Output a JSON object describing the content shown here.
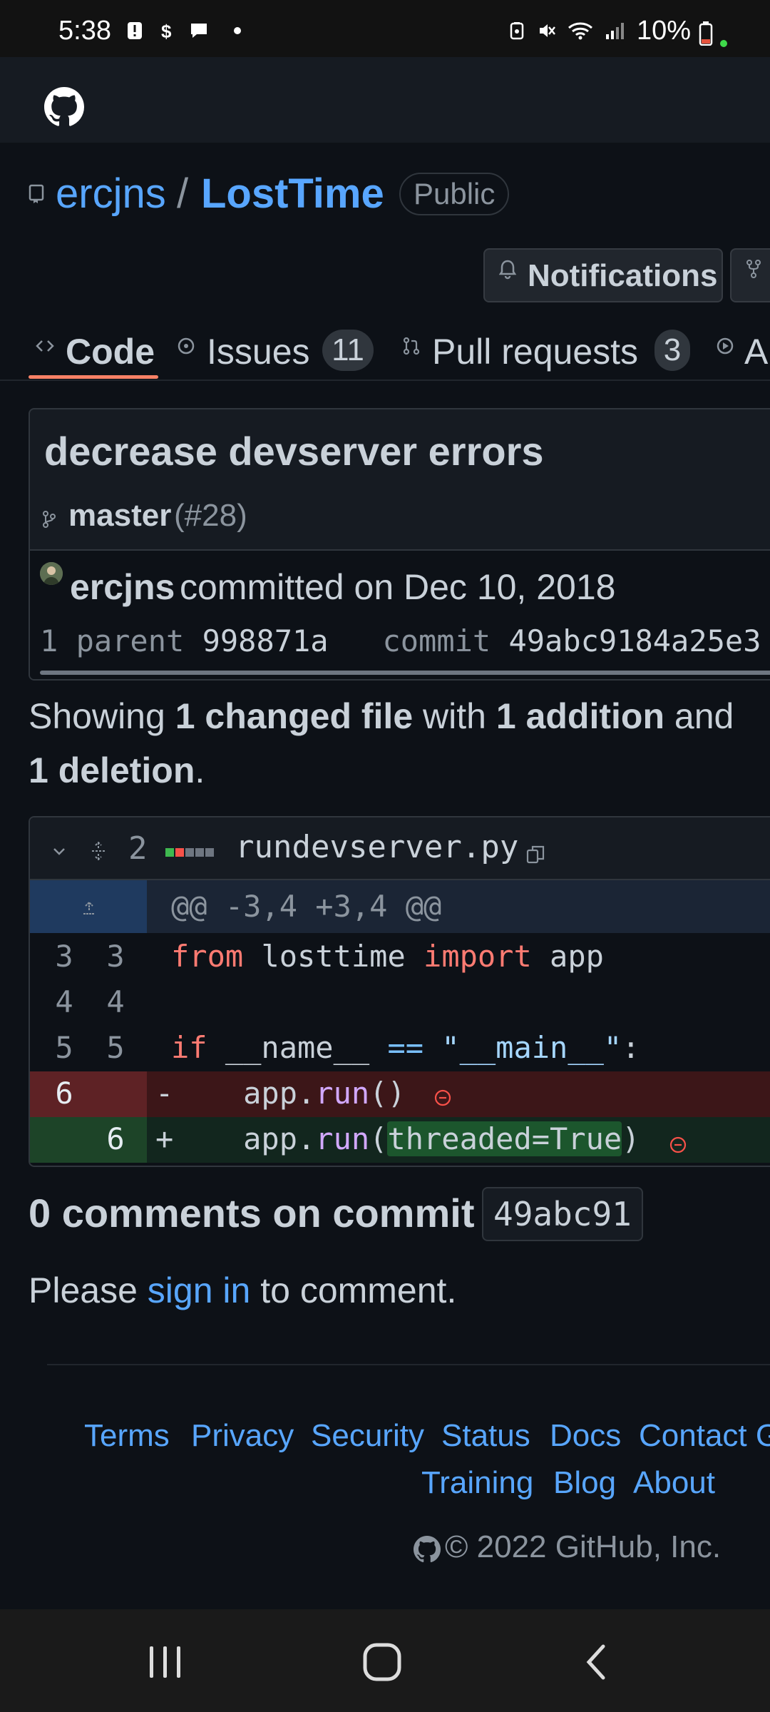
{
  "status_bar": {
    "time": "5:38",
    "battery": "10%"
  },
  "repo": {
    "owner": "ercjns",
    "separator": "/",
    "name": "LostTime",
    "visibility": "Public"
  },
  "actions": {
    "notifications": "Notifications"
  },
  "tabs": [
    {
      "label": "Code"
    },
    {
      "label": "Issues",
      "count": "11"
    },
    {
      "label": "Pull requests",
      "count": "3"
    },
    {
      "label": "A"
    }
  ],
  "commit": {
    "title": "decrease devserver errors",
    "branch": "master",
    "pr_ref": "(#28)",
    "author": "ercjns",
    "committed_text": "committed on Dec 10, 2018",
    "parent_label": "1 parent",
    "parent_sha": "998871a",
    "commit_label": "commit",
    "commit_sha": "49abc9184a25e3"
  },
  "summary": {
    "prefix": "Showing",
    "changed": "1 changed file",
    "with": "with",
    "additions": "1 addition",
    "and": "and",
    "deletions": "1 deletion",
    "end": "."
  },
  "diff": {
    "change_count": "2",
    "filename": "rundevserver.py",
    "hunk_header": "@@ -3,4 +3,4 @@",
    "rows": [
      {
        "old": "3",
        "new": "3"
      },
      {
        "old": "4",
        "new": "4"
      },
      {
        "old": "5",
        "new": "5"
      },
      {
        "old": "6",
        "new": "",
        "sign": "-"
      },
      {
        "old": "",
        "new": "6",
        "sign": "+"
      }
    ],
    "code": {
      "r1_kw1": "from",
      "r1_mod": " losttime ",
      "r1_kw2": "import",
      "r1_name": " app",
      "r3_kw": "if",
      "r3_a": " __name__ ",
      "r3_op": "==",
      "r3_sp": " ",
      "r3_str": "\"__main__\"",
      "r3_colon": ":",
      "r4_a": "    app.",
      "r4_fn": "run",
      "r4_b": "()",
      "r5_a": "    app.",
      "r5_fn": "run",
      "r5_b": "(",
      "r5_hl": "threaded=True",
      "r5_c": ")"
    }
  },
  "comments": {
    "heading": "0 comments on commit",
    "sha": "49abc91",
    "please": "Please",
    "signin": "sign in",
    "to_comment": "to comment."
  },
  "footer": {
    "links": [
      "Terms",
      "Privacy",
      "Security",
      "Status",
      "Docs",
      "Contact G",
      "Training",
      "Blog",
      "About"
    ],
    "copyright": "© 2022 GitHub, Inc."
  },
  "colors": {
    "accent": "#58a6ff",
    "tab_underline": "#f78166",
    "deletion": "#f85149",
    "addition": "#3fb950"
  }
}
